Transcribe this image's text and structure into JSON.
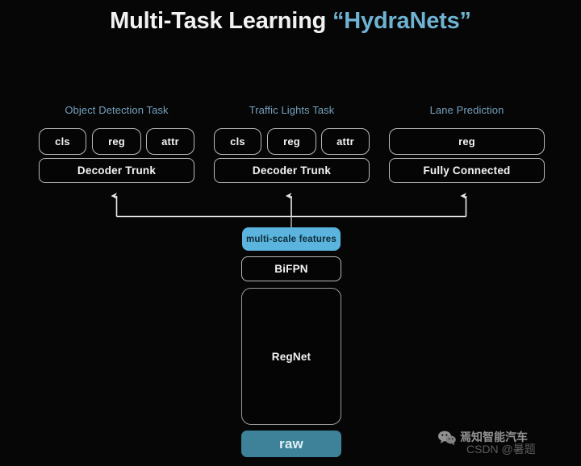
{
  "title": {
    "main": "Multi-Task Learning",
    "accent": "“HydraNets”"
  },
  "colors": {
    "background": "#060606",
    "title_main": "#f2f2f2",
    "title_accent": "#6fb3d2",
    "column_header": "#74a0bd",
    "node_border": "#b9b9b9",
    "node_text": "#f4f4f4",
    "multi_scale_fill": "#5ab4dd",
    "multi_scale_text": "#0e2b38",
    "raw_fill": "#3d8299",
    "raw_text": "#dff0f6",
    "connector": "#e8e8e8"
  },
  "columns": [
    {
      "id": "object-detection",
      "header": "Object Detection Task",
      "heads": [
        "cls",
        "reg",
        "attr"
      ],
      "trunk": "Decoder Trunk"
    },
    {
      "id": "traffic-lights",
      "header": "Traffic Lights Task",
      "heads": [
        "cls",
        "reg",
        "attr"
      ],
      "trunk": "Decoder Trunk"
    },
    {
      "id": "lane-prediction",
      "header": "Lane Prediction",
      "heads": [
        "reg"
      ],
      "trunk": "Fully Connected"
    }
  ],
  "backbone": {
    "multi_scale_features": "multi-scale features",
    "bifpn": "BiFPN",
    "regnet": "RegNet",
    "raw": "raw"
  },
  "watermark": {
    "line1": "焉知智能汽车",
    "line2": "CSDN @暑题",
    "icon": "wechat-icon"
  }
}
